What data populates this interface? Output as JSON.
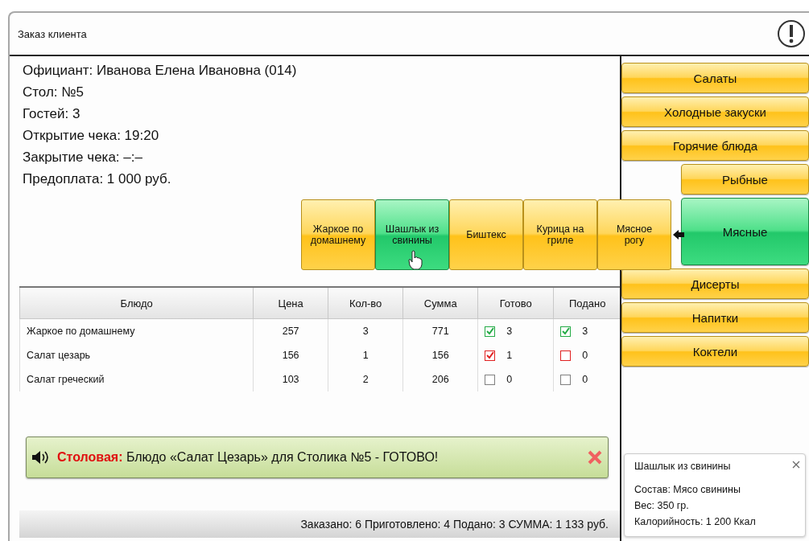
{
  "window": {
    "title": "Заказ клиента"
  },
  "info": [
    "Официант: Иванова Елена Ивановна (014)",
    "Стол: №5",
    "Гостей: 3",
    "Открытие чека: 19:20",
    "Закрытие чека: –:–",
    "Предоплата: 1 000 руб."
  ],
  "dishes": [
    {
      "label": "Жаркое по домашнему",
      "selected": false
    },
    {
      "label": "Шашлык из свинины",
      "selected": true
    },
    {
      "label": "Биштекс",
      "selected": false
    },
    {
      "label": "Курица на гриле",
      "selected": false
    },
    {
      "label": "Мясное рогу",
      "selected": false
    }
  ],
  "table": {
    "columns": [
      "Блюдо",
      "Цена",
      "Кол-во",
      "Сумма",
      "Готово",
      "Подано"
    ],
    "rows": [
      {
        "dish": "Жаркое по домашнему",
        "price": "257",
        "qty": "3",
        "sum": "771",
        "ready": {
          "checked": true,
          "color": "#22aa44",
          "count": "3"
        },
        "served": {
          "checked": true,
          "color": "#22aa44",
          "count": "3"
        }
      },
      {
        "dish": "Салат цезарь",
        "price": "156",
        "qty": "1",
        "sum": "156",
        "ready": {
          "checked": true,
          "color": "#e02020",
          "count": "1"
        },
        "served": {
          "checked": false,
          "color": "#e02020",
          "count": "0"
        }
      },
      {
        "dish": "Салат греческий",
        "price": "103",
        "qty": "2",
        "sum": "206",
        "ready": {
          "checked": false,
          "color": "#808080",
          "count": "0"
        },
        "served": {
          "checked": false,
          "color": "#808080",
          "count": "0"
        }
      }
    ]
  },
  "notification": {
    "source": "Столовая:",
    "message": "Блюдо «Салат Цезарь» для Столика №5 - ГОТОВО!"
  },
  "status_bar": "Заказано: 6 Приготовлено: 4 Подано: 3  СУММА: 1 133 руб.",
  "categories": [
    {
      "label": "Салаты",
      "selected": false
    },
    {
      "label": "Холодные закуски",
      "selected": false
    },
    {
      "label": "Горячие блюда",
      "selected": false,
      "children": [
        {
          "label": "Рыбные",
          "selected": false
        },
        {
          "label": "Мясные",
          "selected": true
        }
      ]
    },
    {
      "label": "Дисерты",
      "selected": false
    },
    {
      "label": "Напитки",
      "selected": false
    },
    {
      "label": "Коктели",
      "selected": false
    }
  ],
  "tooltip": {
    "title": "Шашлык из свинины",
    "lines": [
      "Состав: Мясо свинины",
      "Вес: 350 гр.",
      "Калорийность: 1 200 Ккал"
    ]
  }
}
